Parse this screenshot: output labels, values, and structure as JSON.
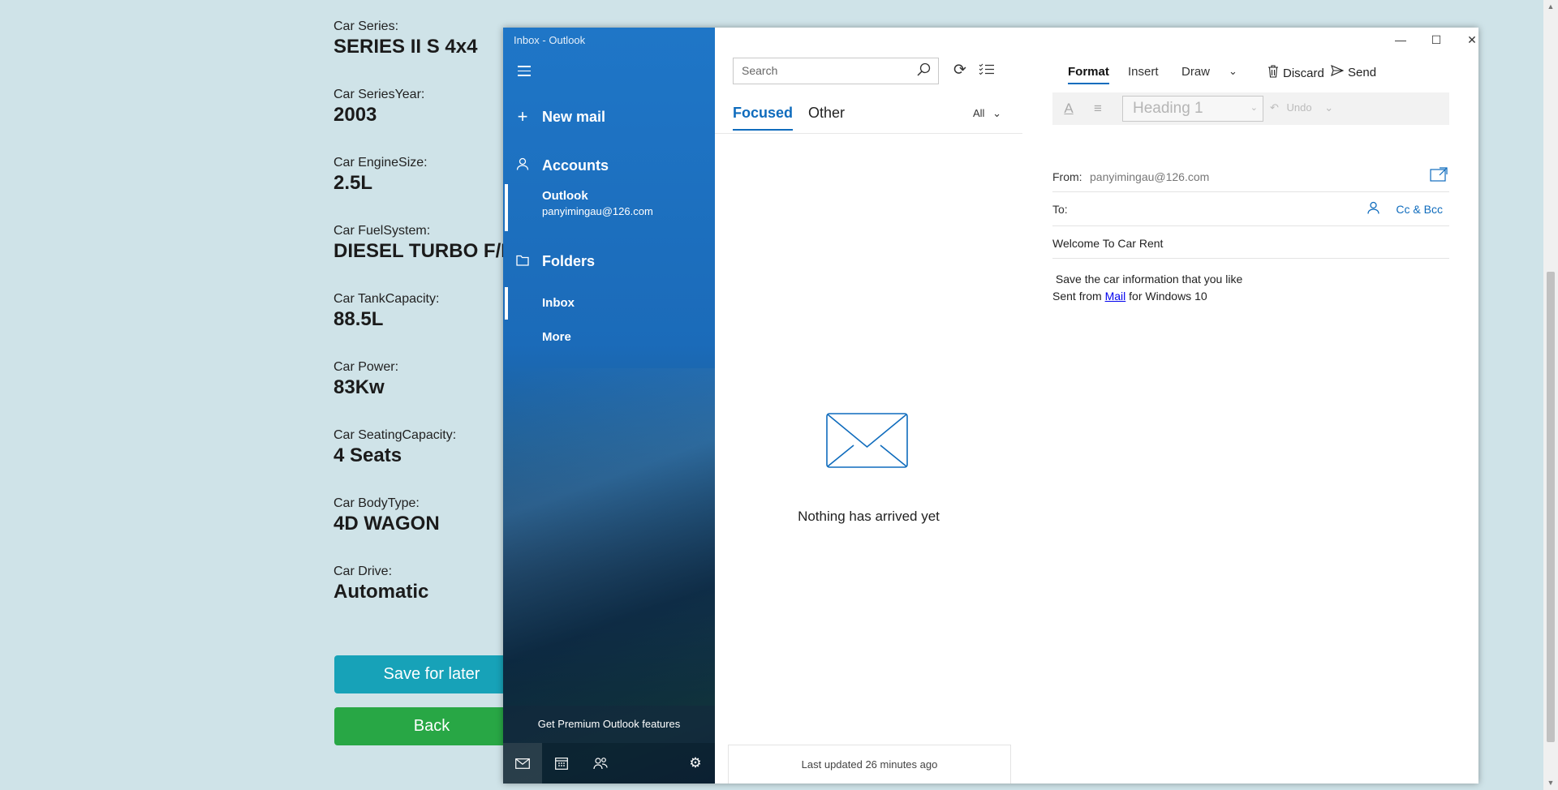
{
  "car_page": {
    "specs": [
      {
        "label": "Car Series:",
        "value": "SERIES II S 4x4"
      },
      {
        "label": "Car SeriesYear:",
        "value": "2003"
      },
      {
        "label": "Car EngineSize:",
        "value": "2.5L"
      },
      {
        "label": "Car FuelSystem:",
        "value": "DIESEL TURBO F/INJ"
      },
      {
        "label": "Car TankCapacity:",
        "value": "88.5L"
      },
      {
        "label": "Car Power:",
        "value": "83Kw"
      },
      {
        "label": "Car SeatingCapacity:",
        "value": "4 Seats"
      },
      {
        "label": "Car BodyType:",
        "value": "4D WAGON"
      },
      {
        "label": "Car Drive:",
        "value": "Automatic"
      }
    ],
    "save_button": "Save for later",
    "back_button": "Back",
    "colors": {
      "save": "#17a2b8",
      "back": "#28a745",
      "background": "#cfe3e8"
    }
  },
  "window": {
    "title": "Inbox - Outlook",
    "controls": {
      "minimize": "—",
      "maximize": "☐",
      "close": "✕"
    }
  },
  "nav": {
    "new_mail": "New mail",
    "accounts": "Accounts",
    "account": {
      "name": "Outlook",
      "email": "panyimingau@126.com"
    },
    "folders": "Folders",
    "folder_items": [
      "Inbox",
      "More"
    ],
    "premium": "Get Premium Outlook features",
    "icons": [
      "mail-icon",
      "calendar-icon",
      "people-icon",
      "settings-icon"
    ]
  },
  "list": {
    "search_placeholder": "Search",
    "tabs": {
      "focused": "Focused",
      "other": "Other"
    },
    "filter": "All",
    "empty_message": "Nothing has arrived yet",
    "last_updated": "Last updated 26 minutes ago"
  },
  "compose": {
    "tabs": [
      "Format",
      "Insert",
      "Draw"
    ],
    "discard": "Discard",
    "send": "Send",
    "heading_style": "Heading 1",
    "undo": "Undo",
    "from_label": "From:",
    "from_value": "panyimingau@126.com",
    "to_label": "To:",
    "ccbcc": "Cc & Bcc",
    "subject": "Welcome To Car Rent",
    "body_line1": "Save the car information that you like",
    "body_prefix": "Sent from ",
    "body_link": "Mail",
    "body_suffix": " for Windows 10",
    "accent": "#0f6cbd"
  }
}
